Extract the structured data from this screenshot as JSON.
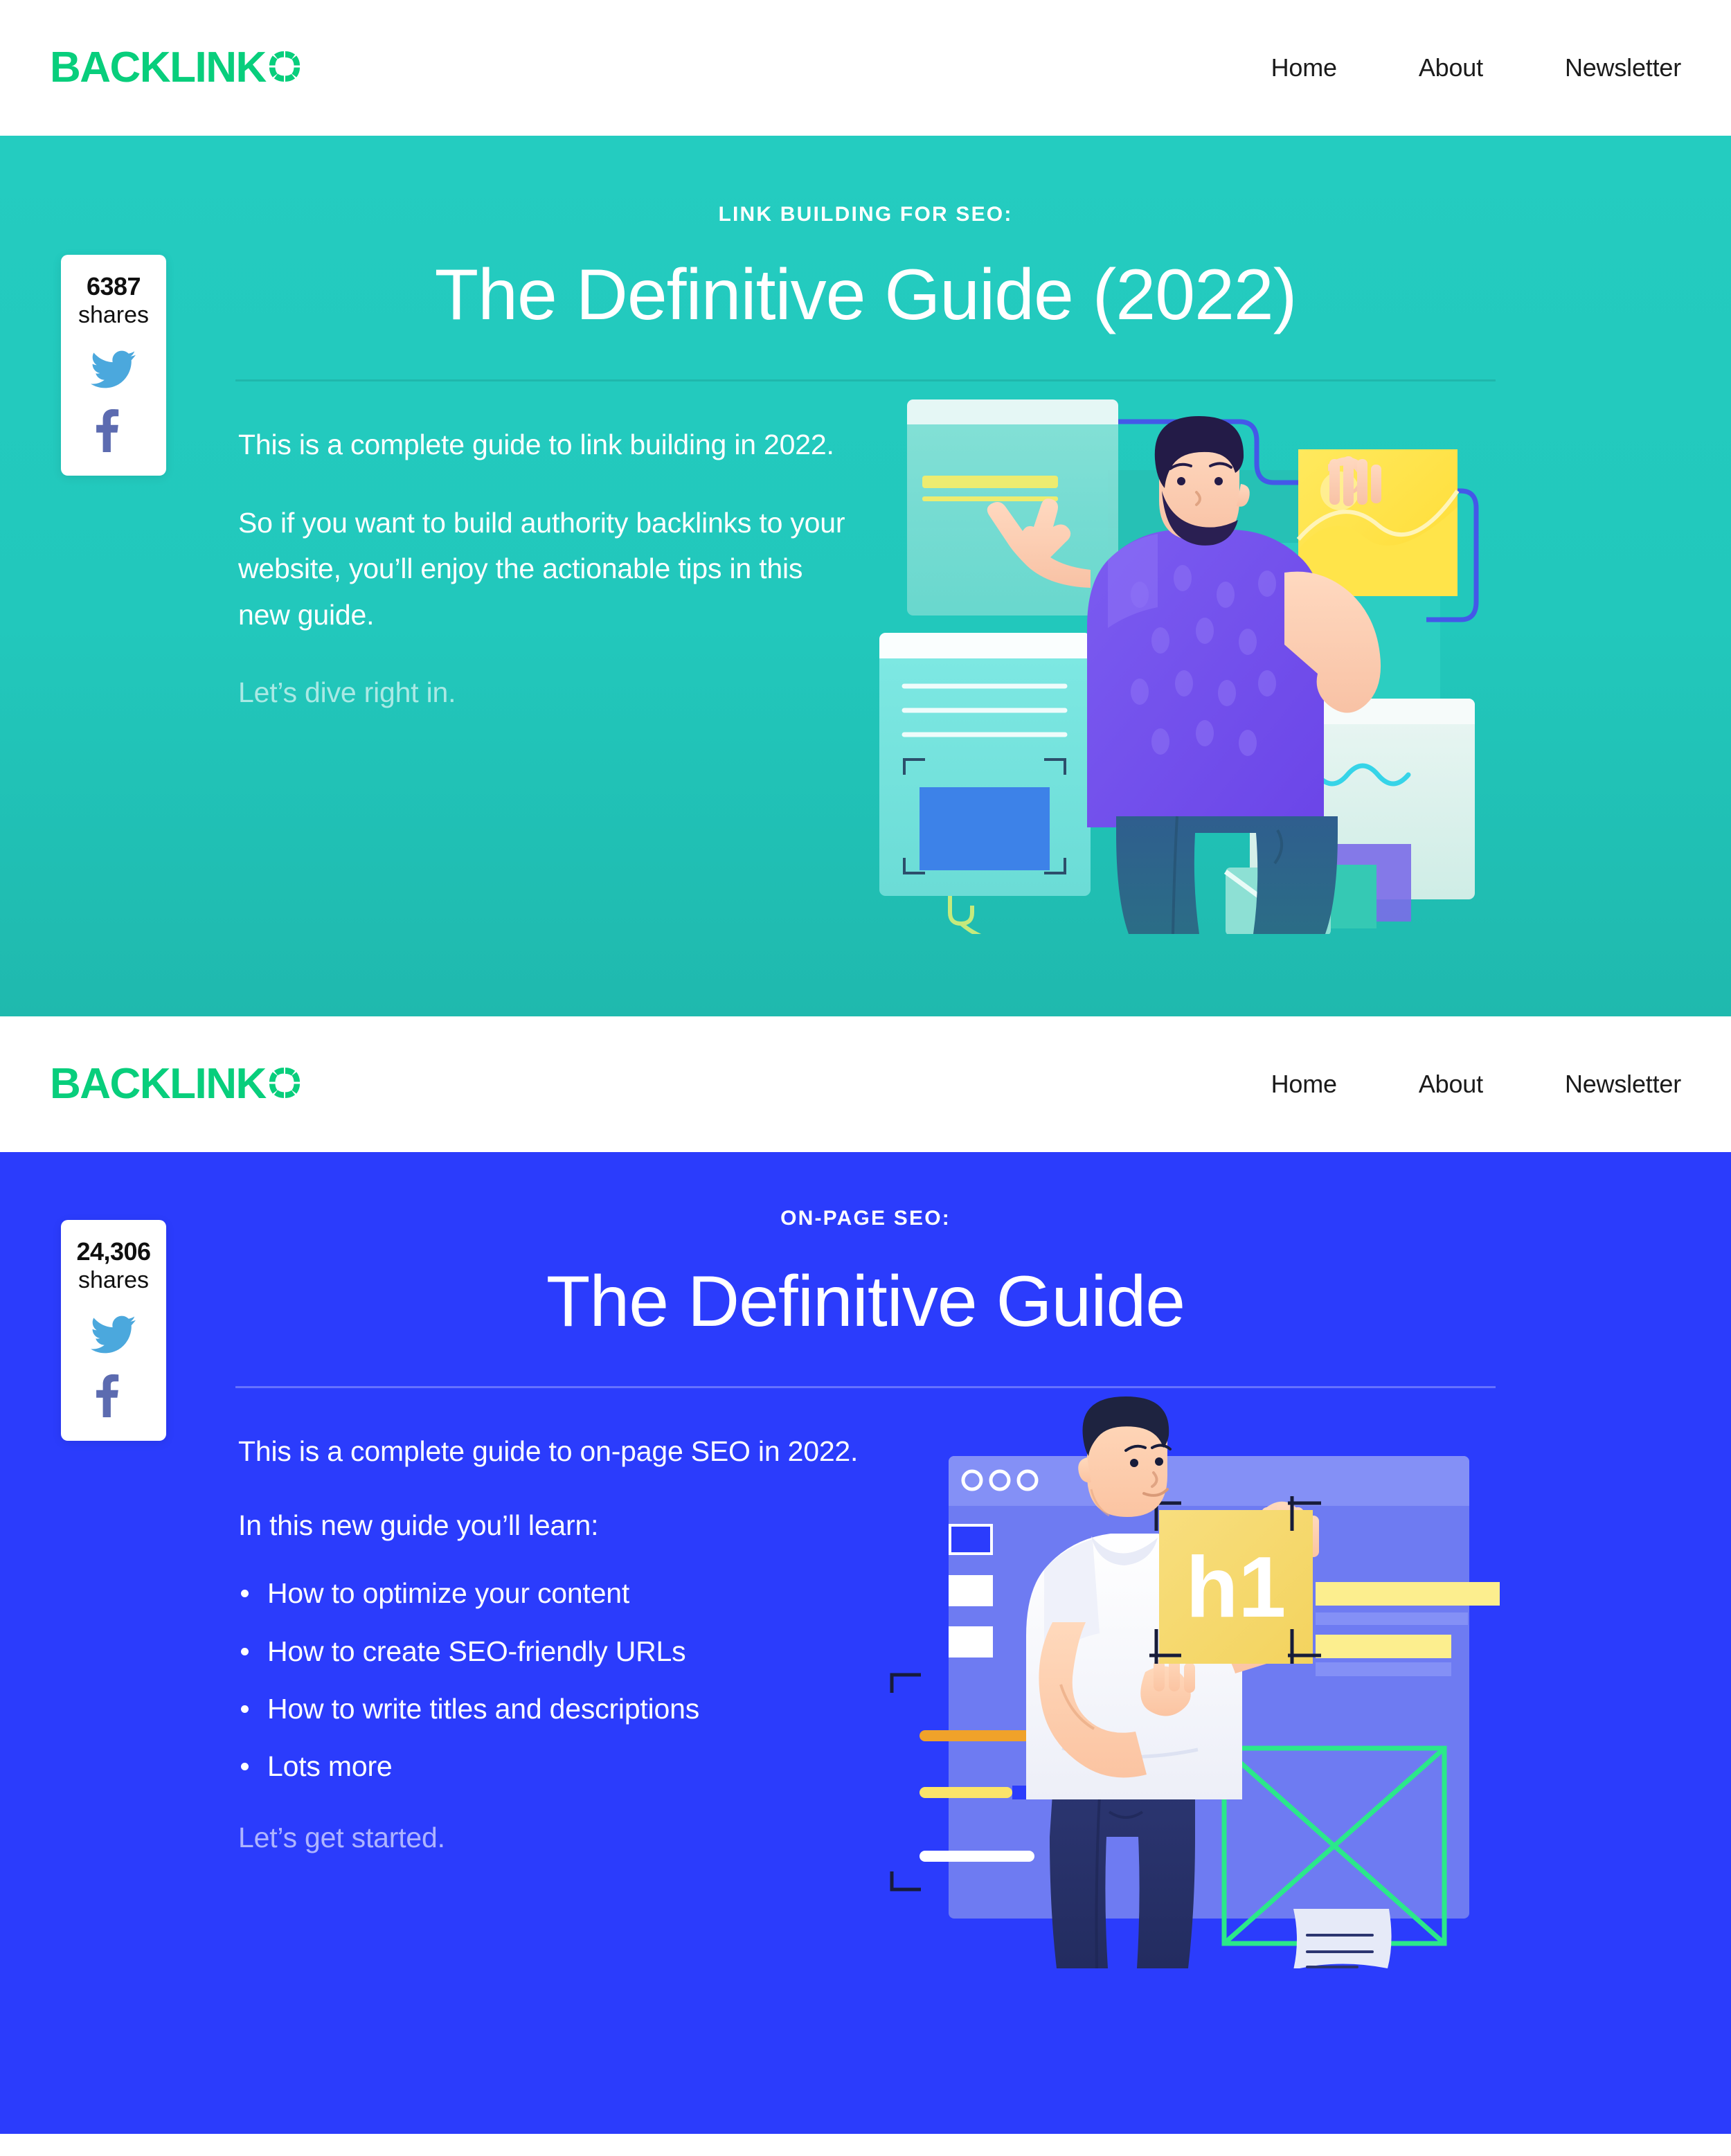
{
  "brand": {
    "logo_word": "BACKLINK",
    "logo_mark_icon": "segmented-circle-icon",
    "logo_color": "#08CE7C"
  },
  "nav": {
    "items": [
      {
        "label": "Home"
      },
      {
        "label": "About"
      },
      {
        "label": "Newsletter"
      }
    ]
  },
  "sections": [
    {
      "id": "link-building",
      "background_color": "#22C8BC",
      "eyebrow": "LINK BUILDING FOR SEO:",
      "title": "The Definitive Guide (2022)",
      "paragraphs": [
        "This is a complete guide to link building in 2022.",
        "So if you want to build authority backlinks to your website, you’ll enjoy the actionable tips in this new guide."
      ],
      "closing": "Let’s dive right in.",
      "share": {
        "count": "6387",
        "label": "shares",
        "twitter_icon": "twitter-bird-icon",
        "facebook_icon": "facebook-f-icon",
        "twitter_color": "#4BA8DD",
        "facebook_color": "#5C6BB0"
      },
      "illustration": {
        "name": "man-pointing-at-browser-windows-illustration",
        "alt": "Bearded man in purple t-shirt pointing at a browser window while holding a yellow chart card"
      }
    },
    {
      "id": "on-page-seo",
      "background_color": "#2B3CFC",
      "eyebrow": "ON-PAGE SEO:",
      "title": "The Definitive Guide",
      "paragraphs": [
        "This is a complete guide to on-page SEO in 2022.",
        "In this new guide you’ll learn:"
      ],
      "bullets": [
        "How to optimize your content",
        "How to create SEO-friendly URLs",
        "How to write titles and descriptions",
        "Lots more"
      ],
      "closing": "Let’s get started.",
      "share": {
        "count": "24,306",
        "label": "shares",
        "twitter_icon": "twitter-bird-icon",
        "facebook_icon": "facebook-f-icon",
        "twitter_color": "#4BA8DD",
        "facebook_color": "#5C6BB0"
      },
      "illustration": {
        "name": "man-holding-h1-card-illustration",
        "alt": "Man in white t-shirt holding a yellow card labelled h1 in front of a browser wireframe",
        "card_label": "h1"
      }
    }
  ]
}
